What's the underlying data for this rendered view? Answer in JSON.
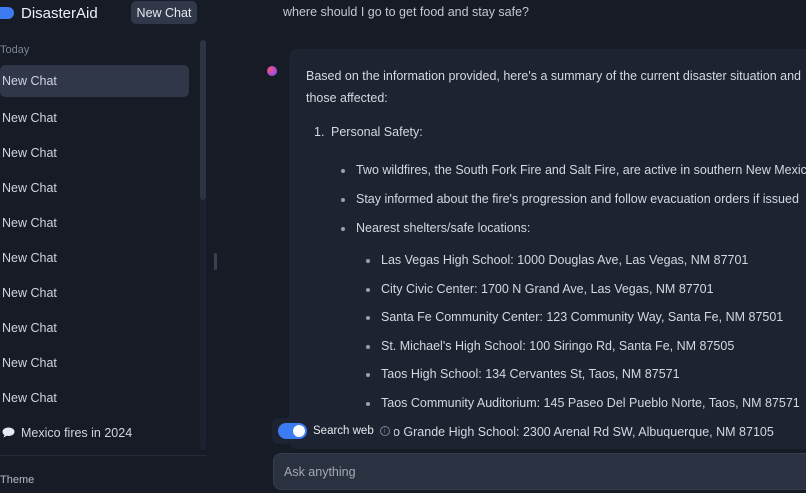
{
  "app": {
    "name": "DisasterAid"
  },
  "sidebar": {
    "new_chat_label": "New Chat",
    "section_label": "Today",
    "items": [
      {
        "label": "New Chat"
      },
      {
        "label": "New Chat"
      },
      {
        "label": "New Chat"
      },
      {
        "label": "New Chat"
      },
      {
        "label": "New Chat"
      },
      {
        "label": "New Chat"
      },
      {
        "label": "New Chat"
      },
      {
        "label": "New Chat"
      },
      {
        "label": "New Chat"
      },
      {
        "label": "New Chat"
      },
      {
        "label": "Mexico fires in 2024",
        "icon": "chat-bubble-icon"
      }
    ],
    "theme_label": "Theme"
  },
  "conversation": {
    "user_message": "where should I go to get food and stay safe?",
    "answer": {
      "intro": "Based on the information provided, here's a summary of the current disaster situation and those affected:",
      "section_number": "1.",
      "section_title": "Personal Safety:",
      "bullets": [
        "Two wildfires, the South Fork Fire and Salt Fire, are active in southern New Mexico",
        "Stay informed about the fire's progression and follow evacuation orders if issued",
        "Nearest shelters/safe locations:"
      ],
      "shelters": [
        "Las Vegas High School: 1000 Douglas Ave, Las Vegas, NM 87701",
        "City Civic Center: 1700 N Grand Ave, Las Vegas, NM 87701",
        "Santa Fe Community Center: 123 Community Way, Santa Fe, NM 87501",
        "St. Michael's High School: 100 Siringo Rd, Santa Fe, NM 87505",
        "Taos High School: 134 Cervantes St, Taos, NM 87571",
        "Taos Community Auditorium: 145 Paseo Del Pueblo Norte, Taos, NM 87571",
        "o Grande High School: 2300 Arenal Rd SW, Albuquerque, NM 87105"
      ]
    }
  },
  "composer": {
    "search_web_label": "Search web",
    "search_web_enabled": true,
    "input_placeholder": "Ask anything",
    "input_value": ""
  },
  "colors": {
    "background": "#161b26",
    "accent": "#3d7bf2",
    "active_item": "#303748"
  }
}
